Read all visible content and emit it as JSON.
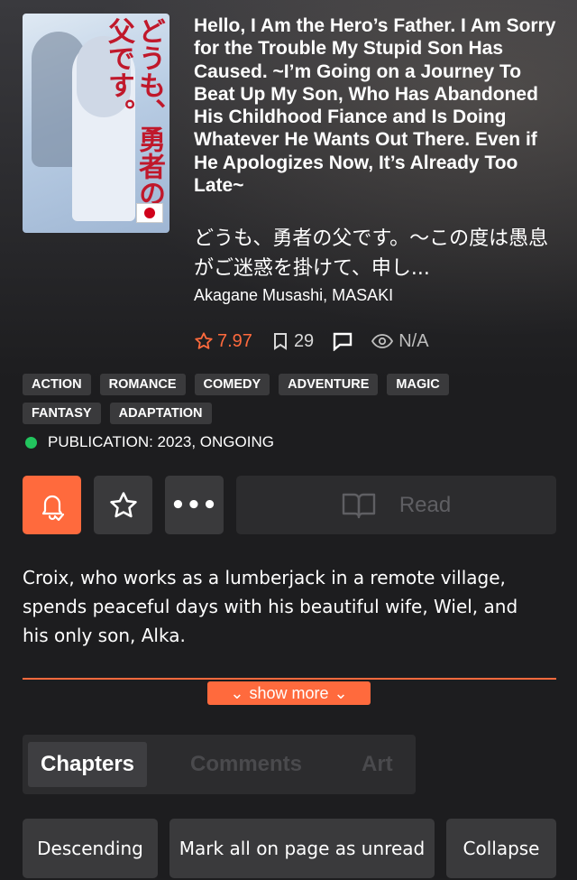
{
  "manga": {
    "title": "Hello, I Am the Hero’s Father. I Am Sorry for the Trouble My Stupid Son Has Caused. ~I’m Going on a Journey To Beat Up My Son, Who Has Abandoned His Childhood Fiance and Is Doing Whatever He Wants Out There. Even if He Apologizes Now, It’s Already Too Late~",
    "alt_title": "どうも、勇者の父です。～この度は愚息がご迷惑を掛けて、申し...",
    "authors": "Akagane Musashi, MASAKI",
    "cover": {
      "title_text": "どうも、勇者の父です。",
      "flag": "japan-flag"
    }
  },
  "stats": {
    "rating": "7.97",
    "bookmarks": "29",
    "views": "N/A",
    "accent_color": "#ff6a3d"
  },
  "tags": {
    "row1": [
      "ACTION",
      "ROMANCE",
      "COMEDY",
      "ADVENTURE",
      "MAGIC"
    ],
    "row2": [
      "FANTASY",
      "ADAPTATION"
    ]
  },
  "publication": {
    "text": "PUBLICATION: 2023, ONGOING",
    "status_color": "#22c55e"
  },
  "actions": {
    "more_label": "•••",
    "read_label": "Read"
  },
  "description": "Croix, who works as a lumberjack in a remote village, spends peaceful days with his beautiful wife, Wiel, and his only son, Alka.",
  "show_more_label": "show more",
  "tabs": [
    "Chapters",
    "Comments",
    "Art"
  ],
  "chapter_actions": {
    "descending": "Descending",
    "mark_all": "Mark all on page as unread",
    "collapse": "Collapse"
  }
}
